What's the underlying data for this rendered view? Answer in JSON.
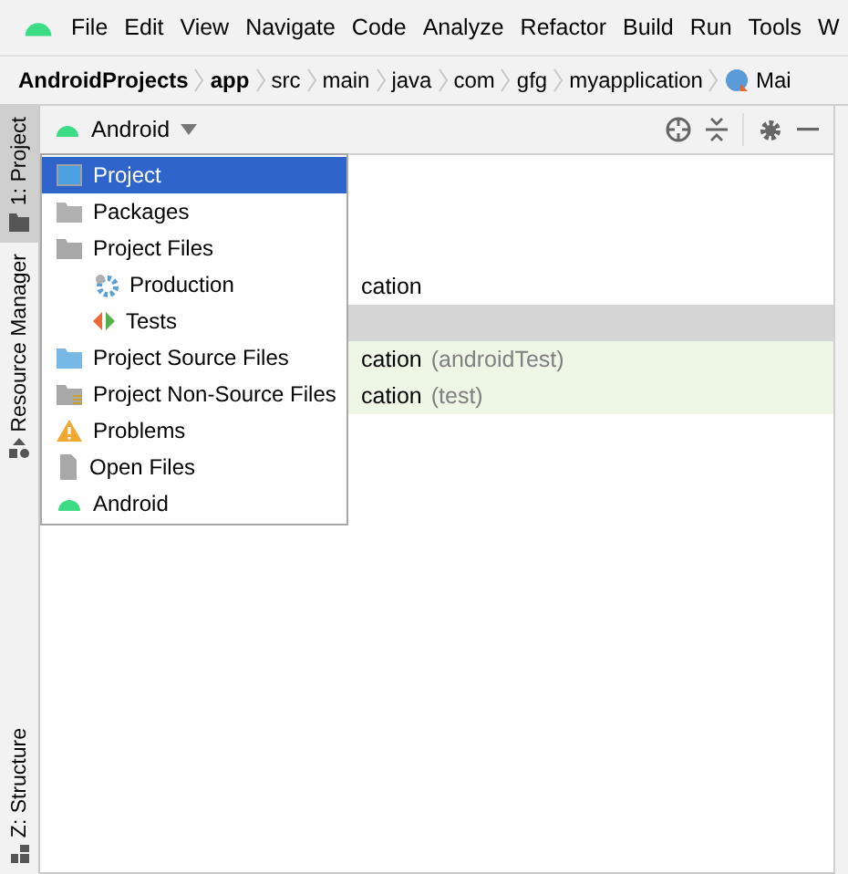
{
  "menu_bar": {
    "items": [
      "File",
      "Edit",
      "View",
      "Navigate",
      "Code",
      "Analyze",
      "Refactor",
      "Build",
      "Run",
      "Tools",
      "W"
    ]
  },
  "breadcrumb": {
    "items": [
      {
        "label": "AndroidProjects",
        "bold": true
      },
      {
        "label": "app",
        "bold": true
      },
      {
        "label": "src",
        "bold": false
      },
      {
        "label": "main",
        "bold": false
      },
      {
        "label": "java",
        "bold": false
      },
      {
        "label": "com",
        "bold": false
      },
      {
        "label": "gfg",
        "bold": false
      },
      {
        "label": "myapplication",
        "bold": false
      },
      {
        "label": "Mai",
        "bold": false
      }
    ]
  },
  "side_tabs": [
    {
      "label": "1: Project",
      "kind": "project",
      "selected": true
    },
    {
      "label": "Resource Manager",
      "kind": "resources",
      "selected": false
    }
  ],
  "bottom_side_tabs": [
    {
      "label": "Z: Structure",
      "kind": "structure",
      "selected": false
    }
  ],
  "view_selector": {
    "label": "Android"
  },
  "tree": {
    "rows": [
      {
        "label": "cation",
        "suffix": "",
        "kind": "plain",
        "selected": false
      },
      {
        "label": "",
        "suffix": "",
        "kind": "plain",
        "selected": true
      },
      {
        "label": "cation",
        "suffix": "(androidTest)",
        "kind": "test",
        "selected": false
      },
      {
        "label": "cation",
        "suffix": "(test)",
        "kind": "test",
        "selected": false
      }
    ]
  },
  "view_menu": {
    "items": [
      {
        "label": "Project",
        "kind": "project",
        "selected": true,
        "indented": false
      },
      {
        "label": "Packages",
        "kind": "packages",
        "selected": false,
        "indented": false
      },
      {
        "label": "Project Files",
        "kind": "folder",
        "selected": false,
        "indented": false
      },
      {
        "label": "Production",
        "kind": "production",
        "selected": false,
        "indented": true
      },
      {
        "label": "Tests",
        "kind": "tests",
        "selected": false,
        "indented": true
      },
      {
        "label": "Project Source Files",
        "kind": "source",
        "selected": false,
        "indented": false
      },
      {
        "label": "Project Non-Source Files",
        "kind": "nonsource",
        "selected": false,
        "indented": false
      },
      {
        "label": "Problems",
        "kind": "problems",
        "selected": false,
        "indented": false
      },
      {
        "label": "Open Files",
        "kind": "openfiles",
        "selected": false,
        "indented": false
      },
      {
        "label": "Android",
        "kind": "android",
        "selected": false,
        "indented": false
      }
    ]
  }
}
